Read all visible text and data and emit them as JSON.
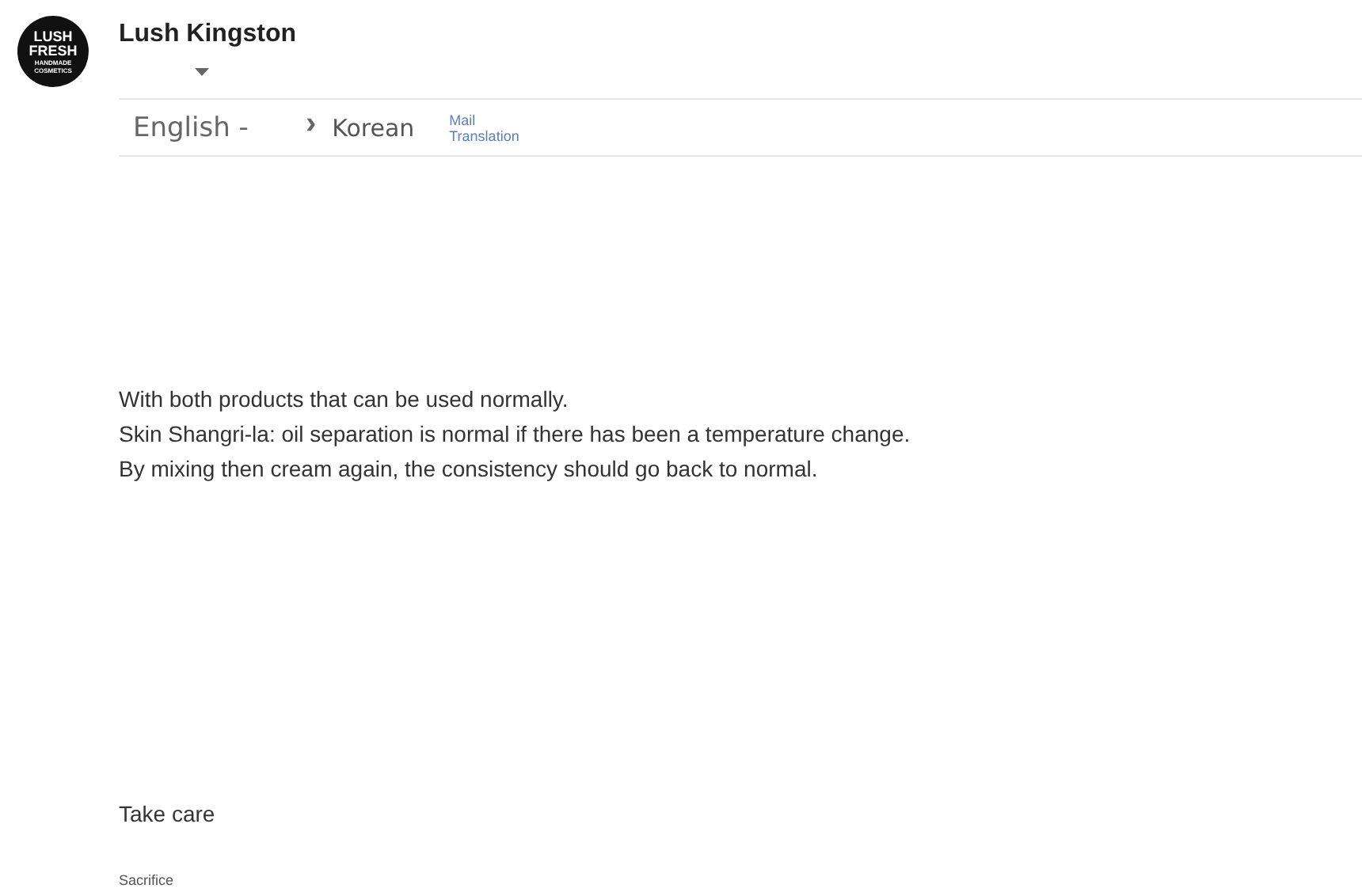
{
  "sender": {
    "name": "Lush Kingston",
    "logo_lines": [
      "LUSH",
      "FRESH",
      "HANDMADE",
      "COSMETICS"
    ]
  },
  "translation": {
    "source": "English -",
    "arrow": "›",
    "target": "Korean",
    "label_lines": [
      "Mail",
      "Translation"
    ]
  },
  "body": [
    "With both products that can be used normally.",
    "Skin Shangri-la: oil separation is normal if there has been a temperature change.",
    "By mixing then cream again, the consistency should go back to normal."
  ],
  "closing": "Take care",
  "signature": "Sacrifice"
}
